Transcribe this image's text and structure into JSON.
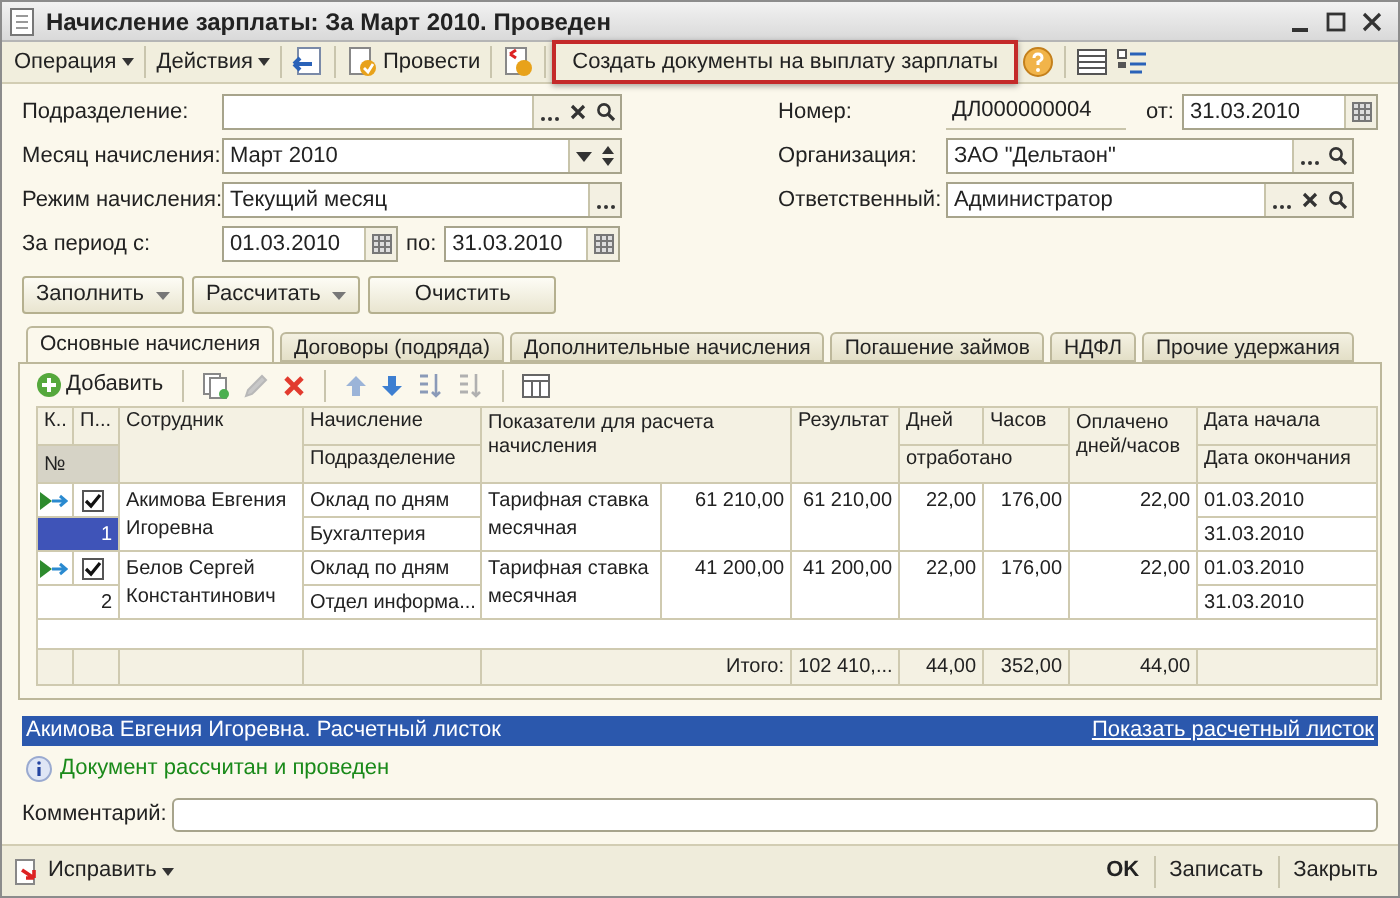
{
  "window": {
    "title": "Начисление зарплаты: За Март 2010. Проведен"
  },
  "toolbar": [
    {
      "kind": "menu",
      "label": "Операция"
    },
    {
      "kind": "menu",
      "label": "Действия"
    },
    {
      "kind": "transfer"
    },
    {
      "kind": "post",
      "label": "Провести"
    },
    {
      "kind": "unpost"
    },
    {
      "kind": "text",
      "label": "Создать документы на выплату зарплаты",
      "highlighted": true
    },
    {
      "kind": "help"
    },
    {
      "kind": "list"
    },
    {
      "kind": "structure"
    }
  ],
  "left_fields": [
    {
      "label": "Подразделение:",
      "kind": "reference",
      "clear": true
    },
    {
      "label": "Месяц начисления:",
      "kind": "month",
      "value": "Март 2010"
    },
    {
      "label": "Режим начисления:",
      "kind": "choice",
      "value": "Текущий месяц"
    },
    {
      "label": "За период с:",
      "kind": "period",
      "value": "01.03.2010",
      "to_label": "по:",
      "to_value": "31.03.2010"
    }
  ],
  "right_fields": [
    {
      "label": "Номер:",
      "kind": "number",
      "value": "ДЛ000000004",
      "date_label": "от:",
      "date_value": "31.03.2010"
    },
    {
      "label": "Организация:",
      "kind": "reference",
      "value": "ЗАО \"Дельтаон\"",
      "clear": false
    },
    {
      "label": "Ответственный:",
      "kind": "reference",
      "value": "Администратор",
      "clear": true
    }
  ],
  "action_buttons": [
    {
      "label": "Заполнить",
      "dropdown": true
    },
    {
      "label": "Рассчитать",
      "dropdown": true
    },
    {
      "label": "Очистить",
      "dropdown": false
    }
  ],
  "tabs": [
    {
      "label": "Основные начисления",
      "selected": true
    },
    {
      "label": "Договоры (подряда)",
      "selected": false
    },
    {
      "label": "Дополнительные начисления",
      "selected": false
    },
    {
      "label": "Погашение займов",
      "selected": false
    },
    {
      "label": "НДФЛ",
      "selected": false
    },
    {
      "label": "Прочие удержания",
      "selected": false
    }
  ],
  "table_toolbar": {
    "add_label": "Добавить",
    "tools": [
      {
        "kind": "copy"
      },
      {
        "kind": "edit",
        "disabled": true
      },
      {
        "kind": "delete"
      },
      {
        "kind": "up"
      },
      {
        "kind": "down"
      },
      {
        "kind": "sort_asc"
      },
      {
        "kind": "sort_desc"
      },
      {
        "kind": "columns"
      }
    ]
  },
  "table": {
    "columns": {
      "k": "К..",
      "p": "П...",
      "number": "№",
      "employee": "Сотрудник",
      "accrual": "Начисление",
      "department": "Подразделение",
      "indicators": "Показатели для расчета начисления",
      "result": "Результат",
      "days": "Дней",
      "hours": "Часов",
      "worked": "отработано",
      "paid": "Оплачено дней/часов",
      "date_start": "Дата начала",
      "date_end": "Дата окончания"
    },
    "rows": [
      {
        "number": "1",
        "checked": true,
        "selected": true,
        "employee": "Акимова Евгения Игоревна",
        "accrual": "Оклад по дням",
        "department": "Бухгалтерия",
        "indicator": "Тарифная ставка месячная",
        "indicator_value": "61 210,00",
        "result": "61 210,00",
        "days": "22,00",
        "hours": "176,00",
        "paid": "22,00",
        "date_start": "01.03.2010",
        "date_end": "31.03.2010"
      },
      {
        "number": "2",
        "checked": true,
        "selected": false,
        "employee": "Белов Сергей Константинович",
        "accrual": "Оклад по дням",
        "department": "Отдел информа...",
        "indicator": "Тарифная ставка месячная",
        "indicator_value": "41 200,00",
        "result": "41 200,00",
        "days": "22,00",
        "hours": "176,00",
        "paid": "22,00",
        "date_start": "01.03.2010",
        "date_end": "31.03.2010"
      }
    ],
    "totals": {
      "label": "Итого:",
      "result": "102 410,...",
      "days": "44,00",
      "hours": "352,00",
      "paid": "44,00"
    }
  },
  "payslip": {
    "title": "Акимова Евгения Игоревна. Расчетный листок",
    "link": "Показать расчетный листок"
  },
  "message": "Документ рассчитан и проведен",
  "comment": {
    "label": "Комментарий:"
  },
  "bottom": {
    "fix_label": "Исправить",
    "buttons": [
      {
        "label": "OK",
        "default": true
      },
      {
        "label": "Записать",
        "default": false
      },
      {
        "label": "Закрыть",
        "default": false
      }
    ]
  }
}
